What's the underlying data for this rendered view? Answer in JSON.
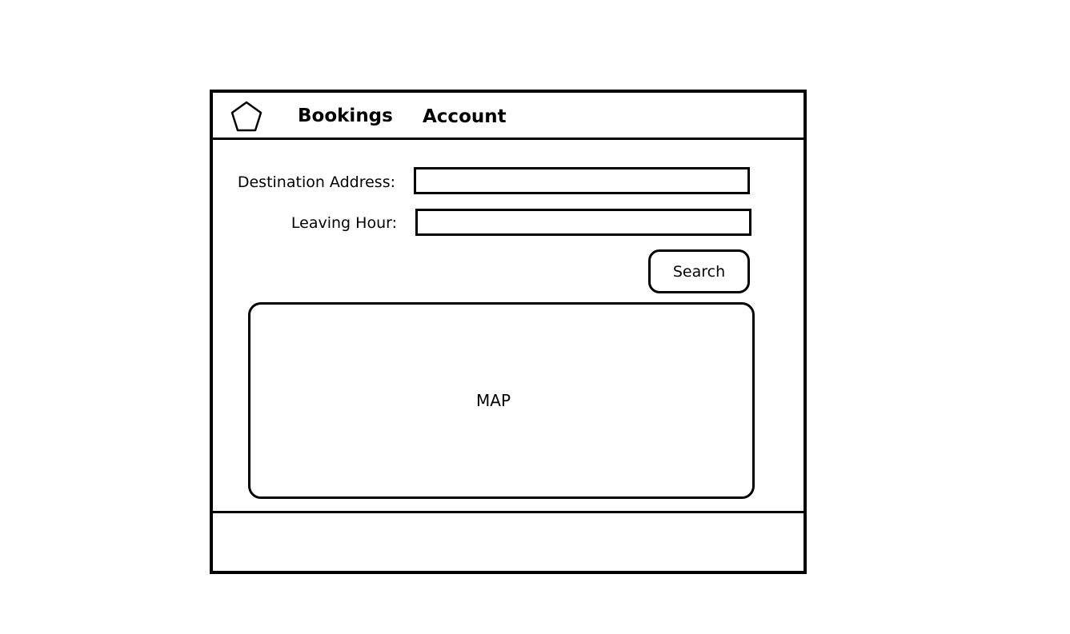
{
  "header": {
    "logo_icon": "pentagon-icon",
    "nav": {
      "bookings_label": "Bookings",
      "account_label": "Account"
    }
  },
  "form": {
    "destination": {
      "label": "Destination Address:",
      "value": "",
      "placeholder": ""
    },
    "leaving_hour": {
      "label": "Leaving Hour:",
      "value": "",
      "placeholder": ""
    },
    "search_label": "Search"
  },
  "map": {
    "label": "MAP"
  },
  "colors": {
    "border": "#000000",
    "background": "#ffffff",
    "text": "#000000"
  }
}
